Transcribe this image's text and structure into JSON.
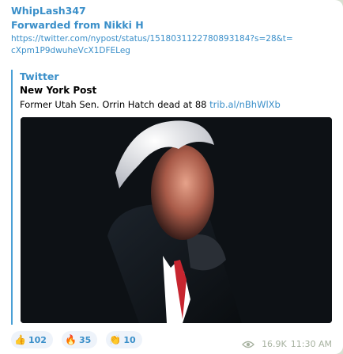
{
  "message": {
    "author": "WhipLash347",
    "forwarded_from": "Forwarded from Nikki H",
    "url": "https://twitter.com/nypost/status/1518031122780893184?s=28&t=cXpm1P9dwuheVcX1DFELeg"
  },
  "link_preview": {
    "site_name": "Twitter",
    "title": "New York Post",
    "description": "Former Utah Sen. Orrin Hatch dead at 88",
    "link": "trib.al/nBhWlXb"
  },
  "reactions": [
    {
      "emoji": "👍",
      "count": "102"
    },
    {
      "emoji": "🔥",
      "count": "35"
    },
    {
      "emoji": "👏",
      "count": "10"
    }
  ],
  "footer": {
    "views_icon": "eye-icon",
    "views": "16.9K",
    "time": "11:30 AM"
  },
  "colors": {
    "accent": "#3a8fc9",
    "preview_bar": "#4aa0d6",
    "meta": "#a7b2a0"
  }
}
